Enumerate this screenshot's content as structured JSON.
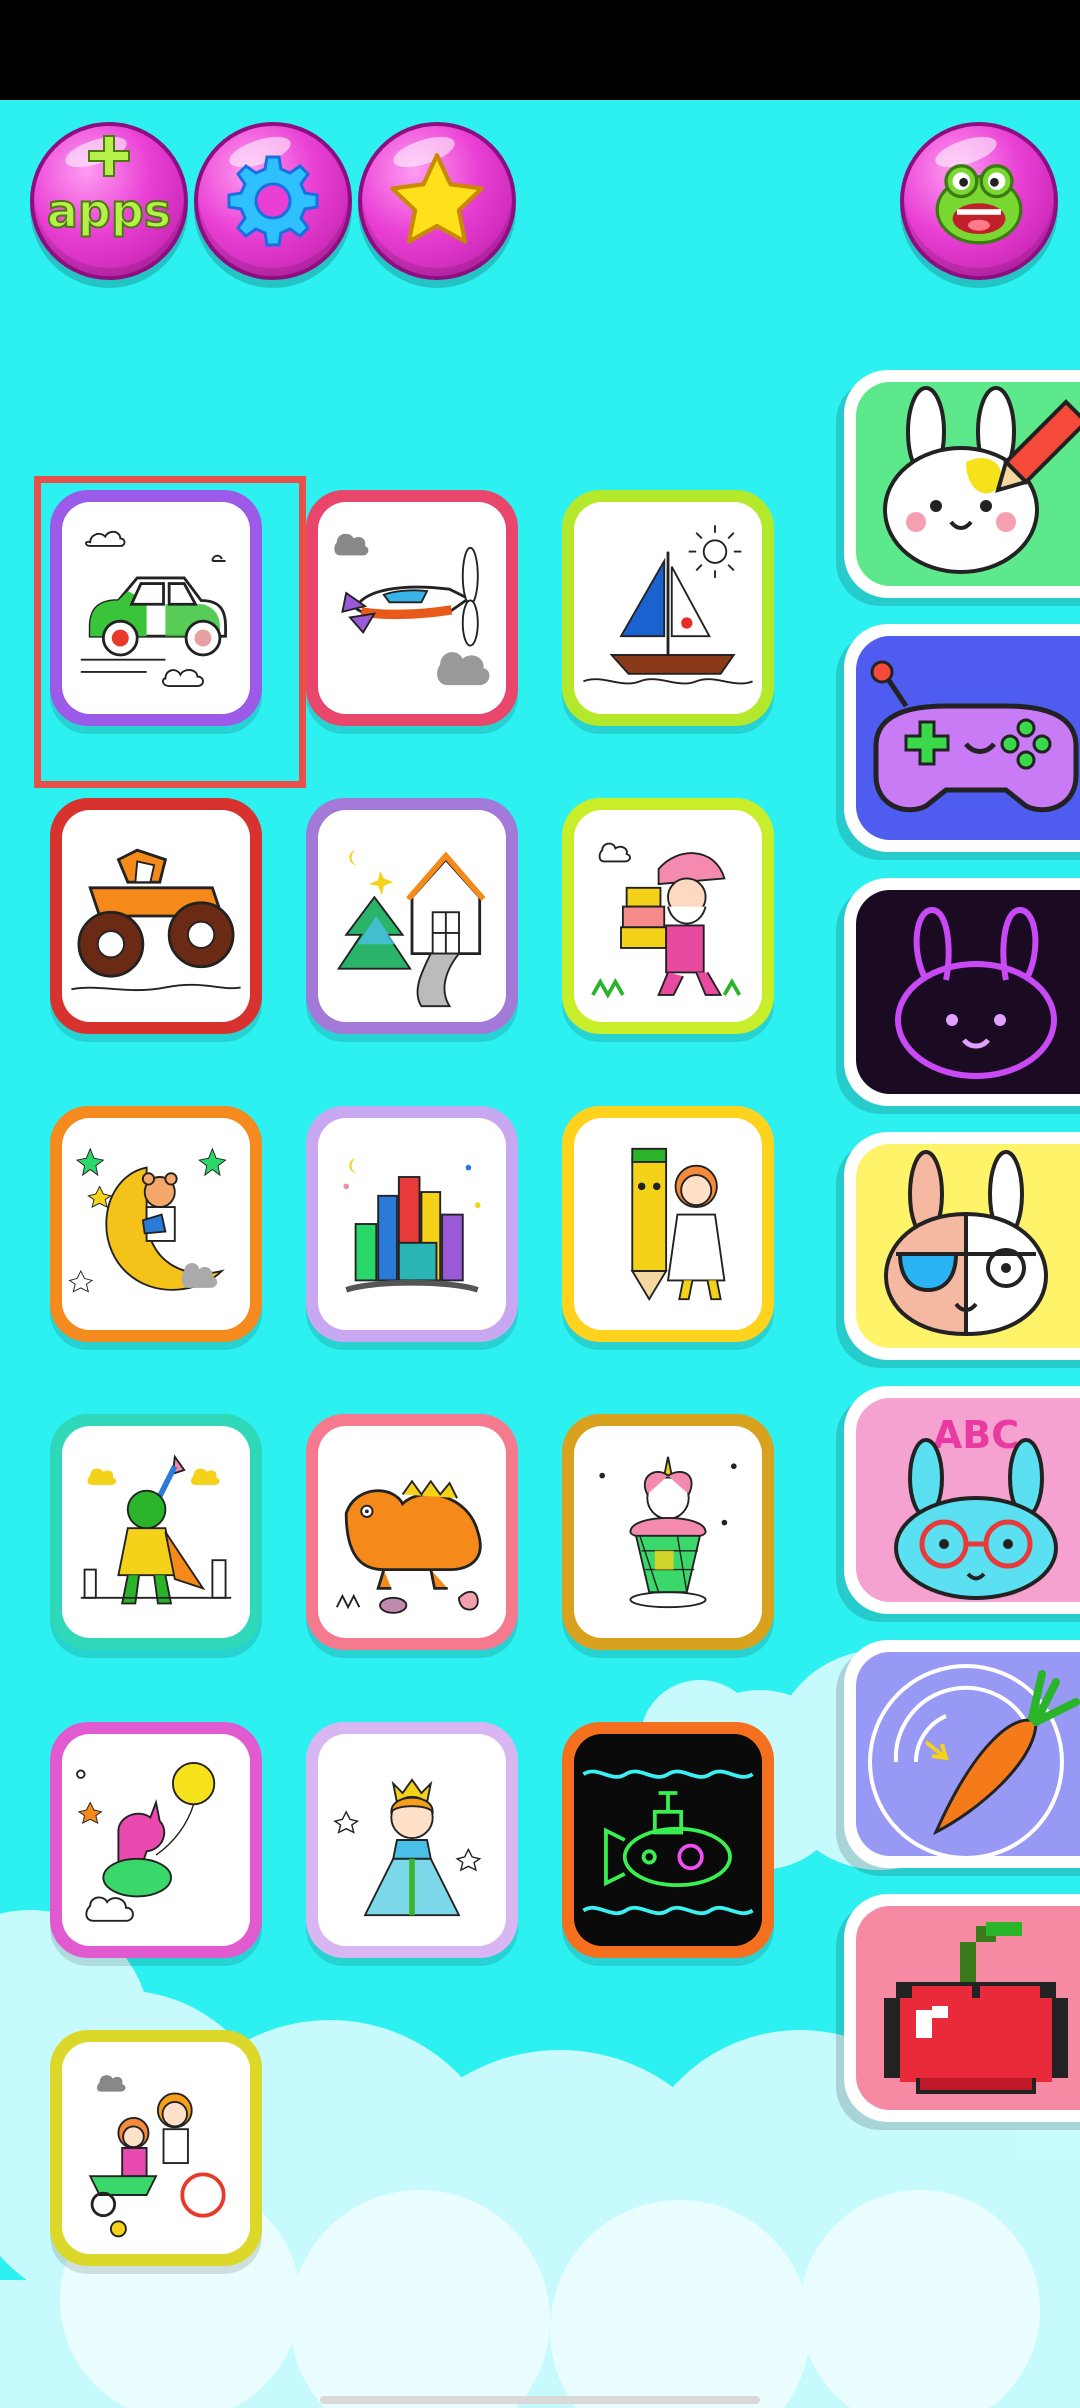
{
  "top_bar": {
    "apps_label": "apps",
    "apps_plus": "+"
  },
  "grid": [
    {
      "name": "car",
      "border": "#9b5ae8"
    },
    {
      "name": "airplane",
      "border": "#e8466a"
    },
    {
      "name": "sailboat",
      "border": "#b4e82a"
    },
    {
      "name": "monster-truck",
      "border": "#d8322e"
    },
    {
      "name": "christmas-house",
      "border": "#a47ad8"
    },
    {
      "name": "santa",
      "border": "#c8ee2a"
    },
    {
      "name": "bear-moon",
      "border": "#f58a1e"
    },
    {
      "name": "castle",
      "border": "#c8a8f0"
    },
    {
      "name": "pencil-girl",
      "border": "#ffd21e"
    },
    {
      "name": "hero",
      "border": "#2ed8b8"
    },
    {
      "name": "dinosaur",
      "border": "#f57a8e"
    },
    {
      "name": "unicorn-cupcake",
      "border": "#d8a21e"
    },
    {
      "name": "unicorn-balloon",
      "border": "#e25ad0"
    },
    {
      "name": "princess",
      "border": "#d8b6f2"
    },
    {
      "name": "submarine-neon",
      "border": "#f5701e"
    },
    {
      "name": "kids-tricycle",
      "border": "#dcd82a"
    }
  ],
  "side_tabs": [
    {
      "name": "coloring-bunny-tab",
      "bg": "#5ee88c",
      "text": ""
    },
    {
      "name": "games-tab",
      "bg": "#4f5cf0",
      "text": ""
    },
    {
      "name": "glow-bunny-tab",
      "bg": "#1a0a22",
      "text": ""
    },
    {
      "name": "cool-bunny-tab",
      "bg": "#fff36a",
      "text": ""
    },
    {
      "name": "abc-bunny-tab",
      "bg": "#f6a2d0",
      "text": "ABC"
    },
    {
      "name": "carrot-tab",
      "bg": "#9898f5",
      "text": ""
    },
    {
      "name": "pixel-apple-tab",
      "bg": "#f58aa2",
      "text": ""
    }
  ]
}
